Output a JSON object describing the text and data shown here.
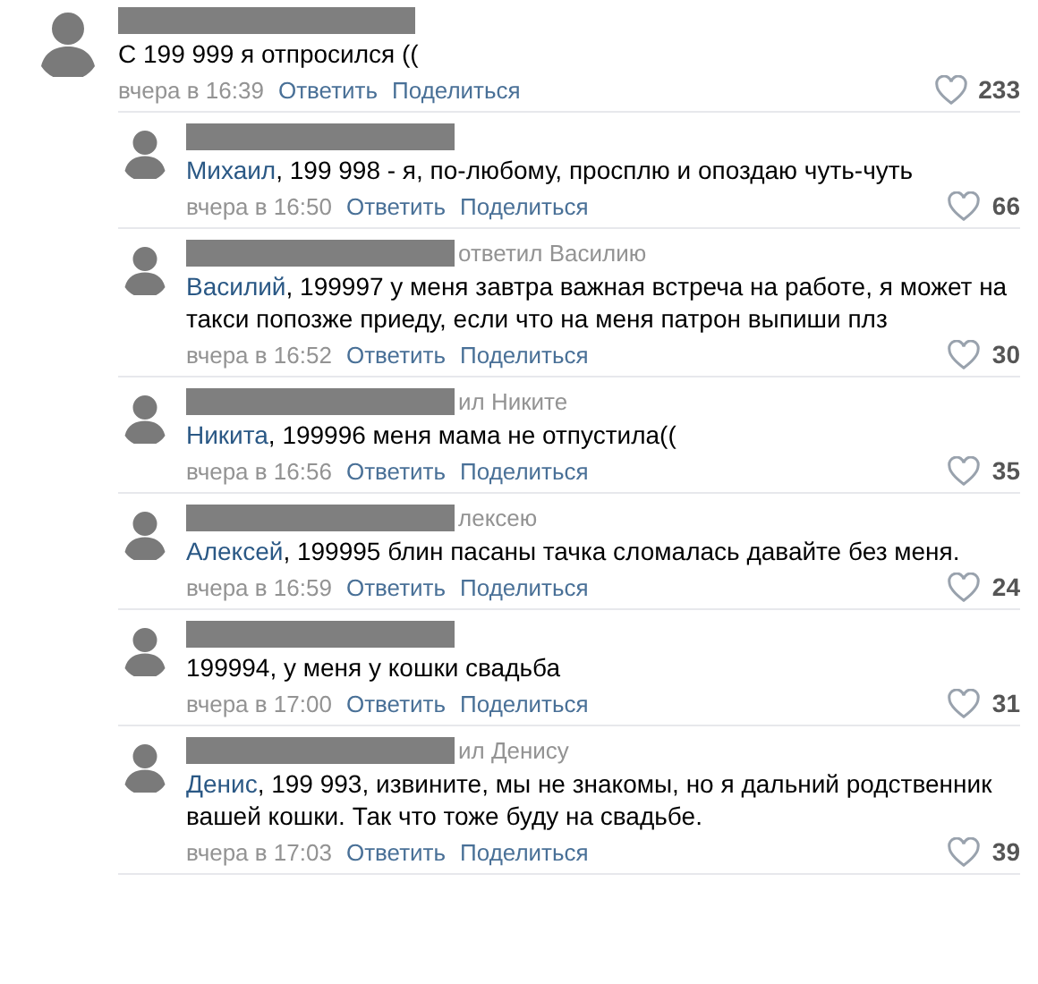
{
  "comment": {
    "text": "С 199 999 я отпросился ((",
    "time": "вчера в 16:39",
    "reply_action": "Ответить",
    "share_action": "Поделиться",
    "likes": "233",
    "replies": [
      {
        "addressee": "Михаил",
        "text": ", 199 998 - я, по-любому, просплю и опоздаю чуть-чуть",
        "time": "вчера в 16:50",
        "reply_action": "Ответить",
        "share_action": "Поделиться",
        "likes": "66"
      },
      {
        "reply_to": "ответил Василию",
        "addressee": "Василий",
        "text": ", 199997 у меня завтра важная встреча на работе, я может на такси попозже приеду, если что на меня патрон выпиши плз",
        "time": "вчера в 16:52",
        "reply_action": "Ответить",
        "share_action": "Поделиться",
        "likes": "30"
      },
      {
        "reply_to": "ил Никите",
        "addressee": "Никита",
        "text": ", 199996 меня мама не отпустила((",
        "time": "вчера в 16:56",
        "reply_action": "Ответить",
        "share_action": "Поделиться",
        "likes": "35"
      },
      {
        "reply_to": "лексею",
        "addressee": "Алексей",
        "text": ", 199995 блин пасаны тачка сломалась давайте без меня.",
        "time": "вчера в 16:59",
        "reply_action": "Ответить",
        "share_action": "Поделиться",
        "likes": "24"
      },
      {
        "text": "199994, у меня у кошки свадьба",
        "time": "вчера в 17:00",
        "reply_action": "Ответить",
        "share_action": "Поделиться",
        "likes": "31"
      },
      {
        "reply_to": "ил Денису",
        "addressee": "Денис",
        "text": ", 199 993, извините, мы не знакомы, но я дальний родственник вашей кошки. Так что тоже буду на свадьбе.",
        "time": "вчера в 17:03",
        "reply_action": "Ответить",
        "share_action": "Поделиться",
        "likes": "39"
      }
    ]
  }
}
